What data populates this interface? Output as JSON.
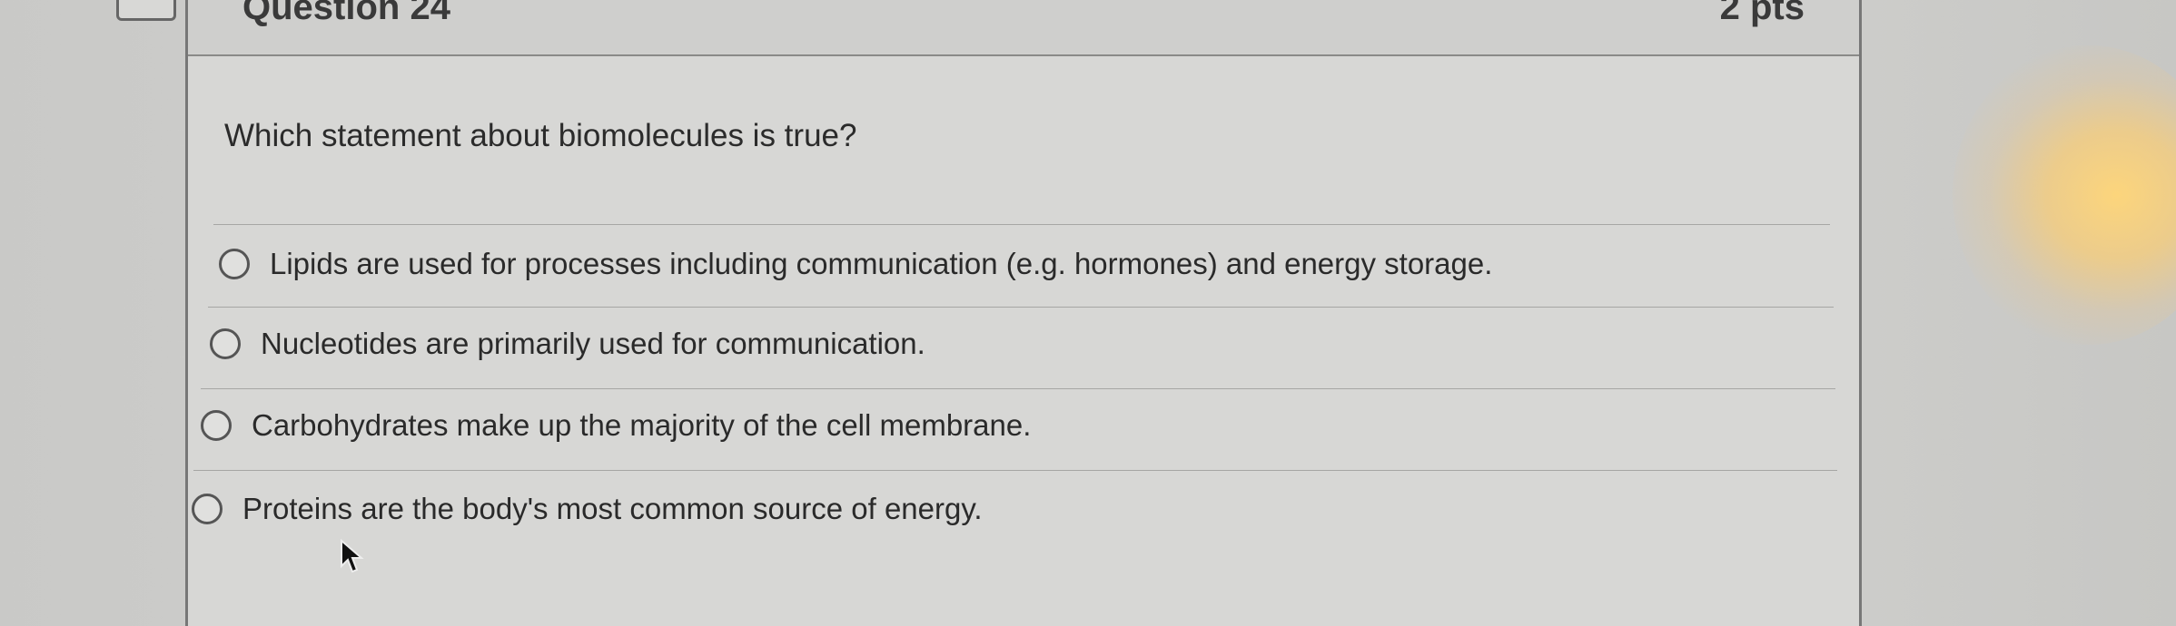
{
  "question": {
    "title": "Question 24",
    "points": "2 pts",
    "prompt": "Which statement about biomolecules is true?",
    "options": [
      "Lipids are used for processes including communication (e.g. hormones) and energy storage.",
      "Nucleotides are primarily used for communication.",
      "Carbohydrates make up the majority of the cell membrane.",
      "Proteins are the body's most common source of energy."
    ]
  },
  "icons": {
    "bookmark": "bookmark-icon",
    "radio": "radio-button-icon",
    "cursor": "mouse-pointer-icon"
  },
  "colors": {
    "background": "#d0d0ce",
    "card": "#d7d7d5",
    "text": "#2a2a2a",
    "glare": "#ffd678"
  }
}
